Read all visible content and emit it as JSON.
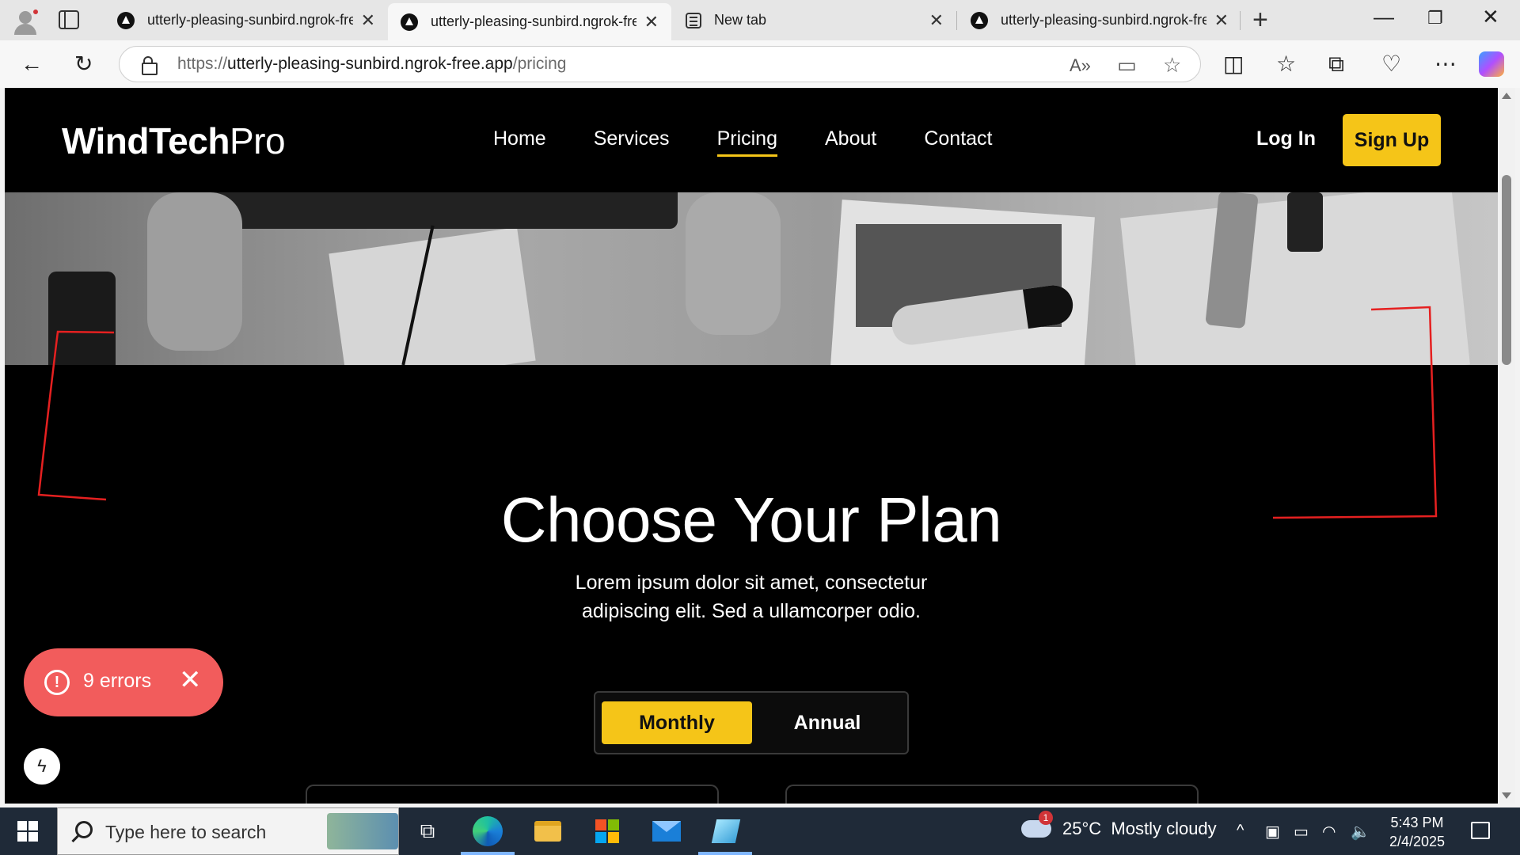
{
  "browser": {
    "tabs": [
      {
        "title": "utterly-pleasing-sunbird.ngrok-fre",
        "active": false
      },
      {
        "title": "utterly-pleasing-sunbird.ngrok-fre",
        "active": true
      },
      {
        "title": "New tab",
        "active": false
      },
      {
        "title": "utterly-pleasing-sunbird.ngrok-fre",
        "active": false
      }
    ],
    "url_prefix": "https://",
    "url_host": "utterly-pleasing-sunbird.ngrok-free.app",
    "url_path": "/pricing"
  },
  "site": {
    "logo_bold": "WindTech",
    "logo_light": "Pro",
    "nav": [
      "Home",
      "Services",
      "Pricing",
      "About",
      "Contact"
    ],
    "active_nav": "Pricing",
    "login_label": "Log In",
    "signup_label": "Sign Up",
    "accent_color": "#f5c518"
  },
  "pricing": {
    "title": "Choose Your Plan",
    "subtitle": "Lorem ipsum dolor sit amet, consectetur adipiscing elit. Sed a ullamcorper odio.",
    "toggle": {
      "monthly": "Monthly",
      "annual": "Annual",
      "selected": "Monthly"
    }
  },
  "dev_overlay": {
    "errors_label": "9 errors",
    "error_color": "#f25c5c"
  },
  "taskbar": {
    "search_placeholder": "Type here to search",
    "weather_temp": "25°C",
    "weather_desc": "Mostly cloudy",
    "weather_badge": "1",
    "time": "5:43 PM",
    "date": "2/4/2025"
  }
}
